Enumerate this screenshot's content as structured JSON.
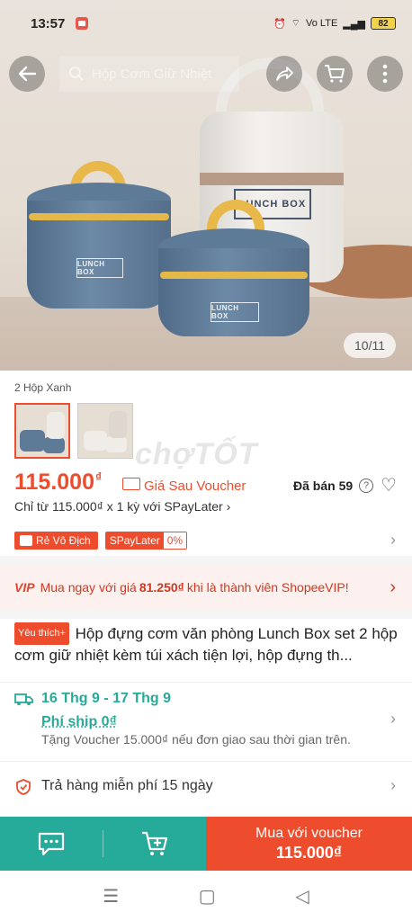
{
  "status_bar": {
    "time": "13:57",
    "battery": "82",
    "network": "Vo LTE"
  },
  "header": {
    "search_placeholder": "Hộp Cơm Giữ Nhiệt"
  },
  "gallery": {
    "counter": "10/11",
    "product_print": "LUNCH BOX"
  },
  "variant": {
    "label": "2 Hộp Xanh"
  },
  "watermark": "chợTỐT",
  "price": {
    "value": "115.000",
    "currency": "₫",
    "voucher_label": "Giá Sau Voucher",
    "sold": "Đã bán 59",
    "installment": "Chỉ từ 115.000₫ x 1 kỳ với SPayLater"
  },
  "badges": {
    "cheapest": "Rẻ Vô Địch",
    "spaylater": "SPayLater",
    "spaylater_rate": "0%"
  },
  "vip": {
    "logo": "VIP",
    "text_before": "Mua ngay với giá",
    "price": "81.250₫",
    "text_after": "khi là thành viên ShopeeVIP!"
  },
  "product": {
    "fav_badge": "Yêu thích+",
    "title": "Hộp đựng cơm văn phòng Lunch Box set 2 hộp cơm giữ nhiệt kèm túi xách tiện lợi, hộp đựng th..."
  },
  "shipping": {
    "dates": "16 Thg 9 - 17 Thg 9",
    "fee": "Phí ship 0₫",
    "note": "Tặng Voucher 15.000₫ nếu đơn giao sau thời gian trên."
  },
  "returns": {
    "text": "Trả hàng miễn phí 15 ngày"
  },
  "bottom_bar": {
    "buy_line1": "Mua với voucher",
    "buy_line2": "115.000₫"
  },
  "colors": {
    "brand": "#ee4d2d",
    "teal": "#26aa99"
  }
}
